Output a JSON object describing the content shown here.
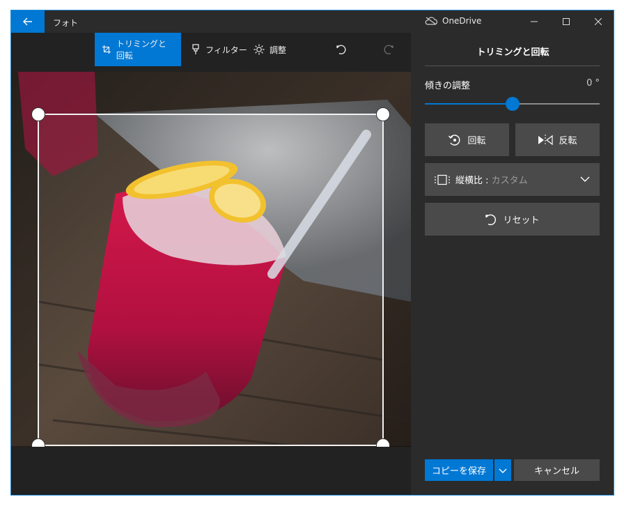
{
  "titlebar": {
    "title": "フォト",
    "cloud_label": "OneDrive"
  },
  "toolbar": {
    "crop_label": "トリミングと回転",
    "filter_label": "フィルター",
    "adjust_label": "調整"
  },
  "panel": {
    "title": "トリミングと回転",
    "tilt_label": "傾きの調整",
    "tilt_value": "0 °",
    "tilt_fraction": 0.5,
    "rotate_label": "回転",
    "flip_label": "反転",
    "aspect_label": "縦横比 : ",
    "aspect_value": "カスタム",
    "reset_label": "リセット"
  },
  "footer": {
    "save_label": "コピーを保存",
    "cancel_label": "キャンセル"
  },
  "colors": {
    "accent": "#0078d4",
    "panel_bg": "#2b2b2b",
    "button_bg": "#4a4a4a"
  }
}
